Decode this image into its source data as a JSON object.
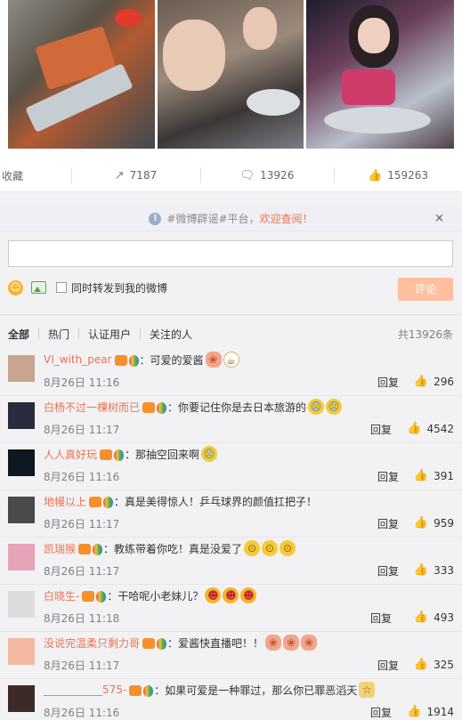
{
  "actions": {
    "favorite": "收藏",
    "repost_count": "7187",
    "comment_count": "13926",
    "like_count": "159263"
  },
  "notice": {
    "topic": "#微博辟谣#平台，",
    "highlight": "欢迎查阅！",
    "close": "×"
  },
  "composer": {
    "input_value": "",
    "repost_label": "同时转发到我的微博",
    "submit_label": "评论"
  },
  "filters": {
    "tabs": [
      "全部",
      "热门",
      "认证用户",
      "关注的人"
    ],
    "total": "共13926条"
  },
  "comments": [
    {
      "user": "VI_with_pear",
      "text": "：可爱的爱酱",
      "time": "8月26日 11:16",
      "reply": "回复",
      "likes": "296",
      "emoji": [
        "pig",
        "cup"
      ]
    },
    {
      "user": "白杨不过一棵树而已",
      "text": "：你要记住你是去日本旅游的",
      "time": "8月26日 11:17",
      "reply": "回复",
      "likes": "4542",
      "emoji": [
        "cry",
        "cry"
      ]
    },
    {
      "user": "人人真好玩",
      "text": "：那抽空回来啊",
      "time": "8月26日 11:16",
      "reply": "回复",
      "likes": "391",
      "emoji": [
        "cry"
      ]
    },
    {
      "user": "地幔以上",
      "text": "：真是美得惊人！乒乓球界的颜值扛把子！",
      "time": "8月26日 11:17",
      "reply": "回复",
      "likes": "959",
      "emoji": []
    },
    {
      "user": "凯瑞猴",
      "text": "：教练带着你吃！真是没爱了",
      "time": "8月26日 11:17",
      "reply": "回复",
      "likes": "333",
      "emoji": [
        "shock",
        "shock",
        "shock"
      ]
    },
    {
      "user": "白晓生-",
      "text": "：干哈呢小老妹儿？",
      "time": "8月26日 11:18",
      "reply": "回复",
      "likes": "493",
      "emoji": [
        "laugh",
        "laugh",
        "laugh"
      ]
    },
    {
      "user": "没说完温柔只剩力哥",
      "text": "：爱酱快直播吧！！",
      "time": "8月26日 11:17",
      "reply": "回复",
      "likes": "325",
      "emoji": [
        "pig",
        "pig",
        "pig"
      ]
    },
    {
      "user": "___________575-",
      "text": "：如果可爱是一种罪过，那么你已罪恶滔天",
      "time": "8月26日 11:16",
      "reply": "回复",
      "likes": "1914",
      "emoji": [
        "doge"
      ]
    }
  ],
  "colors": {
    "accent": "#eb7350",
    "button_disabled": "#ffc09f",
    "panel_bg": "#f2f2f5"
  }
}
